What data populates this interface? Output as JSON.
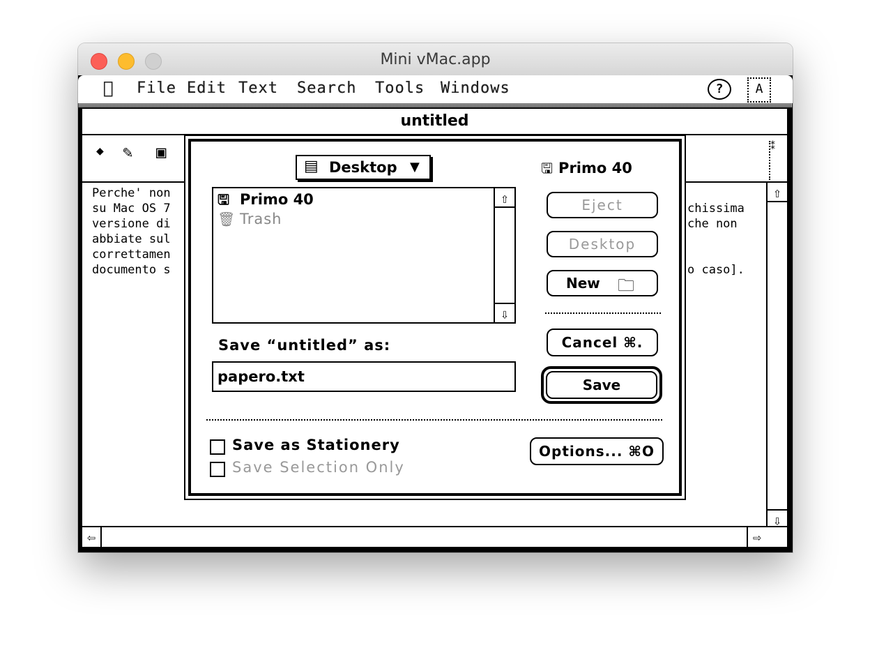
{
  "host_window": {
    "title": "Mini vMac.app"
  },
  "menubar": {
    "apple_icon": "apple-icon",
    "items": [
      "File",
      "Edit",
      "Text",
      "Search",
      "Tools",
      "Windows"
    ],
    "help_label": "?",
    "app_label": "A"
  },
  "document": {
    "title": "untitled",
    "toolbar_icons": [
      "diamond-icon",
      "pen-icon",
      "floppy-icon"
    ],
    "lines_left": [
      "Perche' non",
      "su Mac OS 7",
      "versione di",
      "abbiate sul",
      "correttamen",
      "documento s"
    ],
    "lines_right": [
      "",
      "chissima",
      "che non",
      "",
      "",
      "o caso]."
    ]
  },
  "dialog": {
    "folder_popup": "Desktop",
    "volume_label": "Primo 40",
    "file_list": [
      {
        "name": "Primo 40",
        "icon": "floppy-disk-icon",
        "enabled": true
      },
      {
        "name": "Trash",
        "icon": "trash-icon",
        "enabled": false
      }
    ],
    "buttons": {
      "eject": "Eject",
      "desktop": "Desktop",
      "new": "New",
      "cancel": "Cancel ⌘.",
      "save": "Save",
      "options": "Options... ⌘O"
    },
    "save_prompt": "Save “untitled” as:",
    "filename": "papero.txt",
    "checkboxes": [
      {
        "label": "Save as Stationery",
        "checked": false,
        "enabled": true
      },
      {
        "label": "Save Selection Only",
        "checked": false,
        "enabled": false
      }
    ]
  }
}
